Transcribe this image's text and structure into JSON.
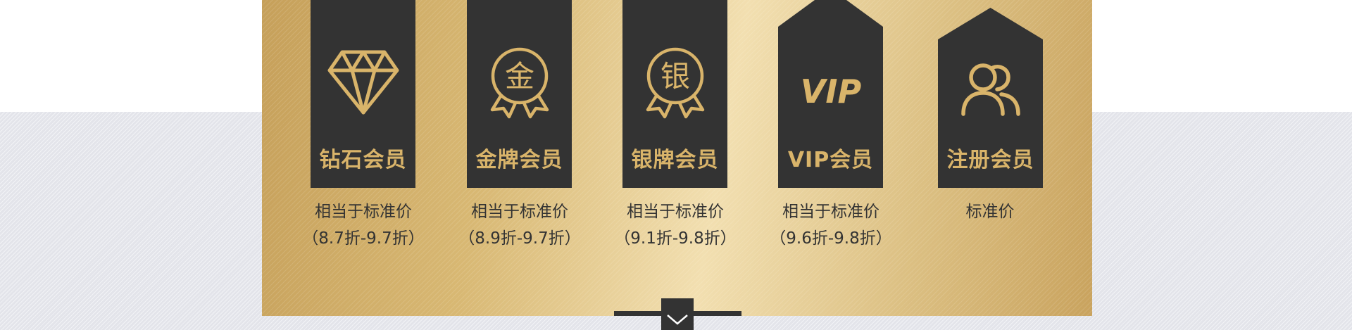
{
  "tiers": [
    {
      "name": "钻石会员",
      "icon": "diamond-icon",
      "desc_line1": "相当于标准价",
      "desc_line2": "（8.7折-9.7折）"
    },
    {
      "name": "金牌会员",
      "icon": "gold-medal-icon",
      "icon_char": "金",
      "desc_line1": "相当于标准价",
      "desc_line2": "（8.9折-9.7折）"
    },
    {
      "name": "银牌会员",
      "icon": "silver-medal-icon",
      "icon_char": "银",
      "desc_line1": "相当于标准价",
      "desc_line2": "（9.1折-9.8折）"
    },
    {
      "name": "VIP会员",
      "icon": "vip-icon",
      "icon_text": "VIP",
      "desc_line1": "相当于标准价",
      "desc_line2": "（9.6折-9.8折）"
    },
    {
      "name": "注册会员",
      "icon": "users-icon",
      "desc_line1": "标准价",
      "desc_line2": ""
    }
  ],
  "colors": {
    "gold": "#d9b46a",
    "dark": "#333333",
    "band": "#e3e4ea"
  },
  "toggle": {
    "icon": "chevron-down-icon"
  }
}
